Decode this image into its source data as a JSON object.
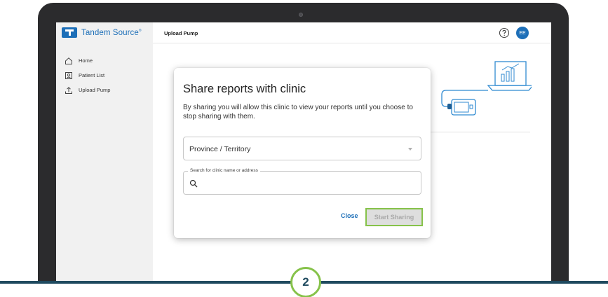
{
  "sidebar": {
    "brand": "Tandem Source",
    "brand_mark": "®",
    "items": [
      {
        "label": "Home",
        "icon": "home-icon"
      },
      {
        "label": "Patient List",
        "icon": "patient-list-icon"
      },
      {
        "label": "Upload Pump",
        "icon": "upload-icon"
      }
    ]
  },
  "header": {
    "title": "Upload Pump",
    "help_icon": "help-icon",
    "avatar_initials": "EE"
  },
  "modal": {
    "title": "Share reports with clinic",
    "description": "By sharing you will allow this clinic to view your reports until you choose to stop sharing with them.",
    "province_select": "Province / Territory",
    "search_label": "Search for clinic name or address",
    "search_value": "",
    "close_label": "Close",
    "start_label": "Start Sharing"
  },
  "step": "2",
  "colors": {
    "brand_blue": "#1d6fb8",
    "highlight_green": "#86c24a",
    "base_navy": "#1f4a5f"
  }
}
